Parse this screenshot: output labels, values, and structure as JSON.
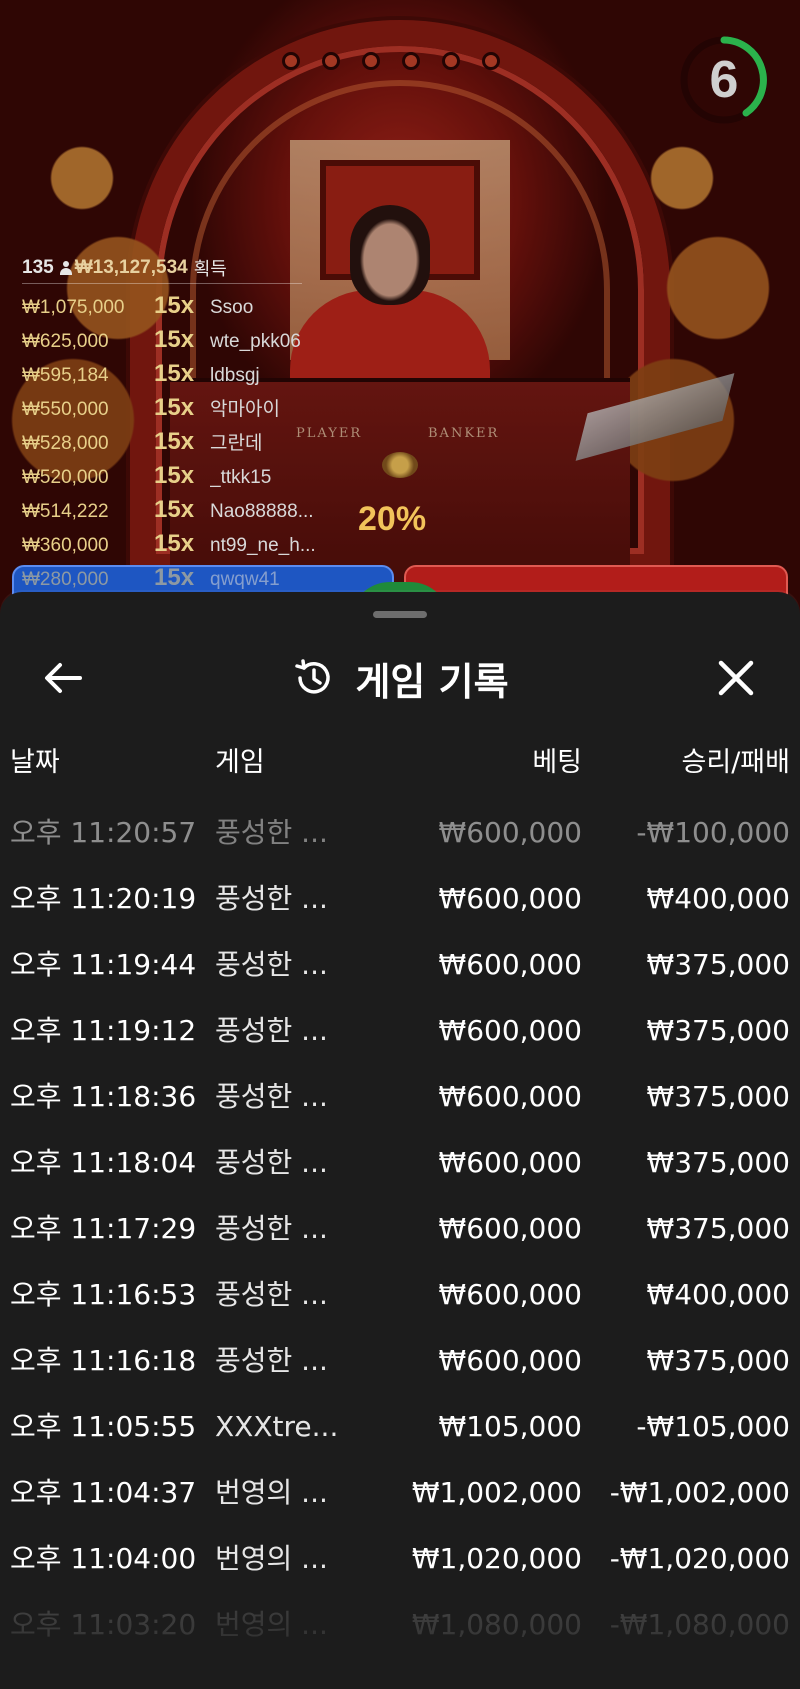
{
  "countdown": {
    "value": "6",
    "ring_color": "#2bb24c"
  },
  "live": {
    "table_labels": {
      "player": "PLAYER",
      "banker": "BANKER"
    },
    "multiplier_badge": "20%"
  },
  "winners": {
    "count": "135",
    "total_prize": "₩13,127,534",
    "total_label": "획득",
    "rows": [
      {
        "amount": "₩1,075,000",
        "multiplier": "15x",
        "user": "Ssoo"
      },
      {
        "amount": "₩625,000",
        "multiplier": "15x",
        "user": "wte_pkk06"
      },
      {
        "amount": "₩595,184",
        "multiplier": "15x",
        "user": "ldbsgj"
      },
      {
        "amount": "₩550,000",
        "multiplier": "15x",
        "user": "악마아이"
      },
      {
        "amount": "₩528,000",
        "multiplier": "15x",
        "user": "그란데"
      },
      {
        "amount": "₩520,000",
        "multiplier": "15x",
        "user": "_ttkk15"
      },
      {
        "amount": "₩514,222",
        "multiplier": "15x",
        "user": "Nao88888..."
      },
      {
        "amount": "₩360,000",
        "multiplier": "15x",
        "user": "nt99_ne_h..."
      },
      {
        "amount": "₩280,000",
        "multiplier": "15x",
        "user": "qwqw41"
      }
    ]
  },
  "sheet": {
    "title": "게임 기록",
    "icons": {
      "back": "arrow-left-icon",
      "history": "history-icon",
      "close": "close-icon"
    },
    "columns": {
      "date": "날짜",
      "game": "게임",
      "bet": "베팅",
      "win_loss": "승리/패배"
    },
    "rows": [
      {
        "date": "오후 11:20:57",
        "game": "풍성한 ...",
        "bet": "₩600,000",
        "win_loss": "-₩100,000"
      },
      {
        "date": "오후 11:20:19",
        "game": "풍성한 ...",
        "bet": "₩600,000",
        "win_loss": "₩400,000"
      },
      {
        "date": "오후 11:19:44",
        "game": "풍성한 ...",
        "bet": "₩600,000",
        "win_loss": "₩375,000"
      },
      {
        "date": "오후 11:19:12",
        "game": "풍성한 ...",
        "bet": "₩600,000",
        "win_loss": "₩375,000"
      },
      {
        "date": "오후 11:18:36",
        "game": "풍성한 ...",
        "bet": "₩600,000",
        "win_loss": "₩375,000"
      },
      {
        "date": "오후 11:18:04",
        "game": "풍성한 ...",
        "bet": "₩600,000",
        "win_loss": "₩375,000"
      },
      {
        "date": "오후 11:17:29",
        "game": "풍성한 ...",
        "bet": "₩600,000",
        "win_loss": "₩375,000"
      },
      {
        "date": "오후 11:16:53",
        "game": "풍성한 ...",
        "bet": "₩600,000",
        "win_loss": "₩400,000"
      },
      {
        "date": "오후 11:16:18",
        "game": "풍성한 ...",
        "bet": "₩600,000",
        "win_loss": "₩375,000"
      },
      {
        "date": "오후 11:05:55",
        "game": "XXXtre...",
        "bet": "₩105,000",
        "win_loss": "-₩105,000"
      },
      {
        "date": "오후 11:04:37",
        "game": "번영의 ...",
        "bet": "₩1,002,000",
        "win_loss": "-₩1,002,000"
      },
      {
        "date": "오후 11:04:00",
        "game": "번영의 ...",
        "bet": "₩1,020,000",
        "win_loss": "-₩1,020,000"
      },
      {
        "date": "오후 11:03:20",
        "game": "번영의 ...",
        "bet": "₩1,080,000",
        "win_loss": "-₩1,080,000"
      }
    ]
  }
}
